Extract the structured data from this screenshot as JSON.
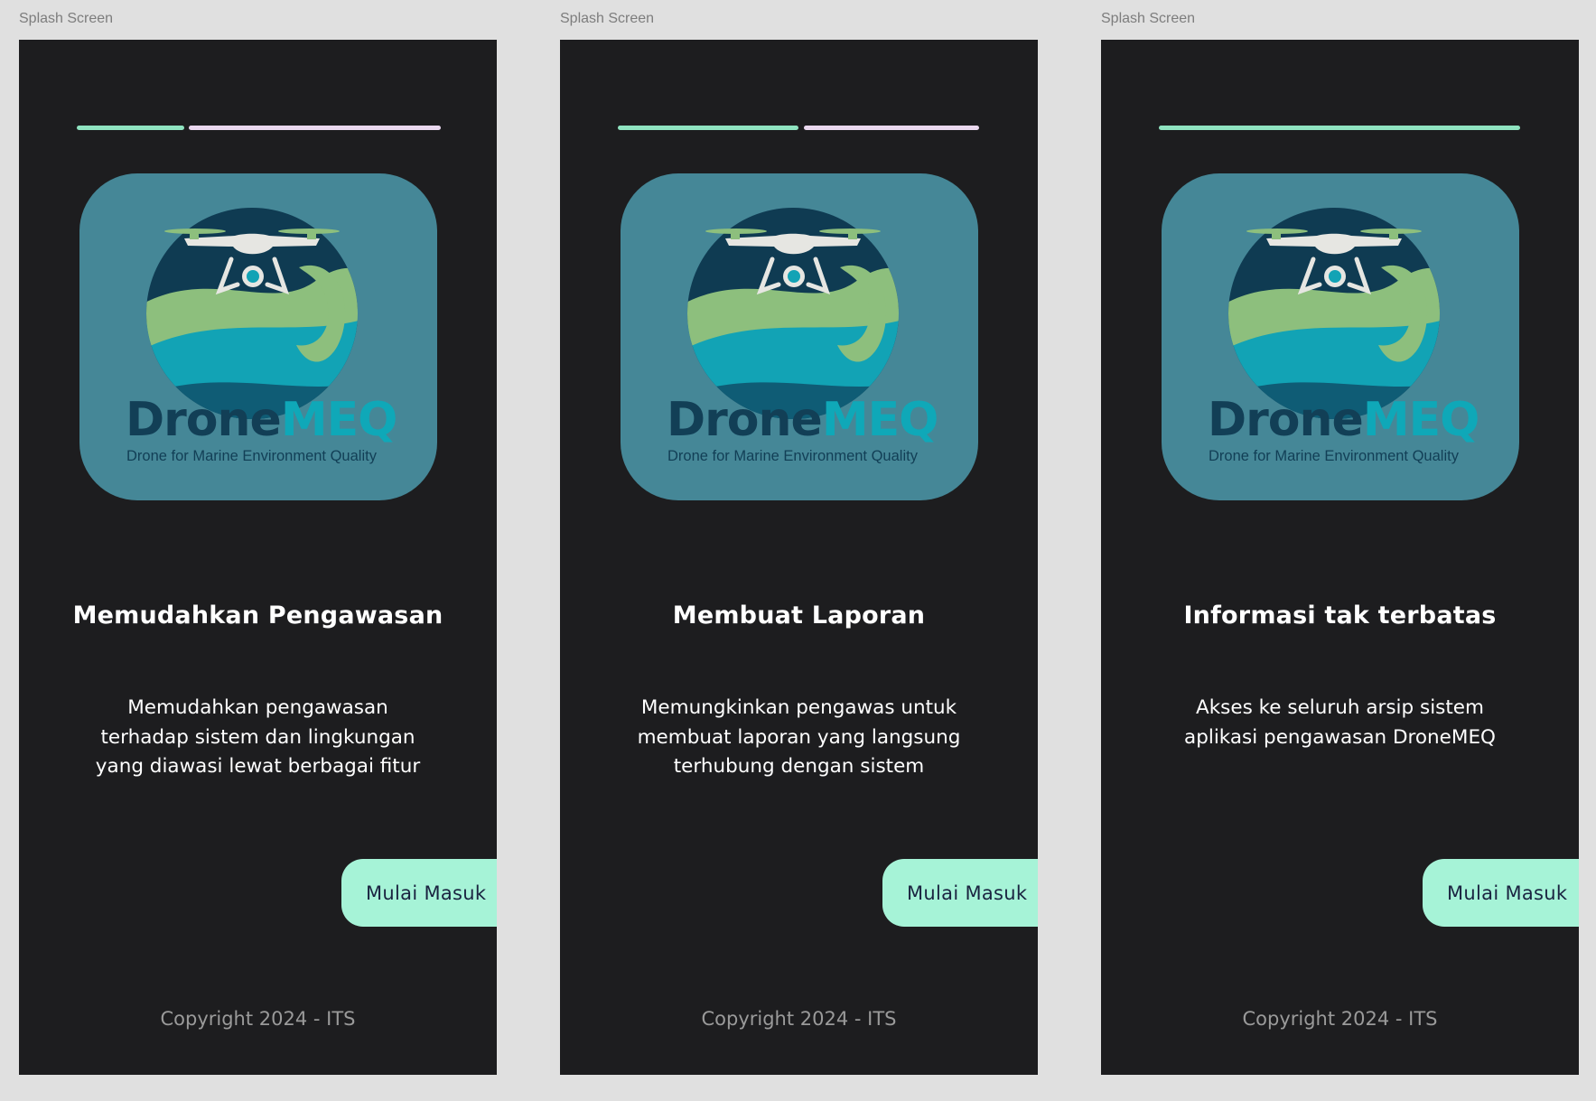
{
  "frame_label": "Splash Screen",
  "logo": {
    "brand_part1": "Drone",
    "brand_part2": "MEQ",
    "tagline": "Drone for Marine Environment Quality"
  },
  "button_label": "Mulai Masuk",
  "copyright": "Copyright 2024 - ITS",
  "colors": {
    "canvas": "#e0e0e0",
    "screen": "#1d1d1f",
    "progress_active": "#8fe3c0",
    "progress_rest": "#ead8ef",
    "logo_card": "#458797",
    "button": "#a6f3d7",
    "button_text": "#1a2340"
  },
  "screens": [
    {
      "progress_fraction": 0.3,
      "title": "Memudahkan Pengawasan",
      "desc_lines": [
        "Memudahkan pengawasan",
        "terhadap sistem dan lingkungan",
        "yang diawasi lewat berbagai fitur"
      ]
    },
    {
      "progress_fraction": 0.51,
      "title": "Membuat Laporan",
      "desc_lines": [
        "Memungkinkan pengawas untuk",
        "membuat laporan yang langsung",
        "terhubung dengan sistem"
      ]
    },
    {
      "progress_fraction": 1.0,
      "title": "Informasi tak terbatas",
      "desc_lines": [
        "Akses ke seluruh arsip sistem",
        "aplikasi pengawasan DroneMEQ"
      ]
    }
  ]
}
